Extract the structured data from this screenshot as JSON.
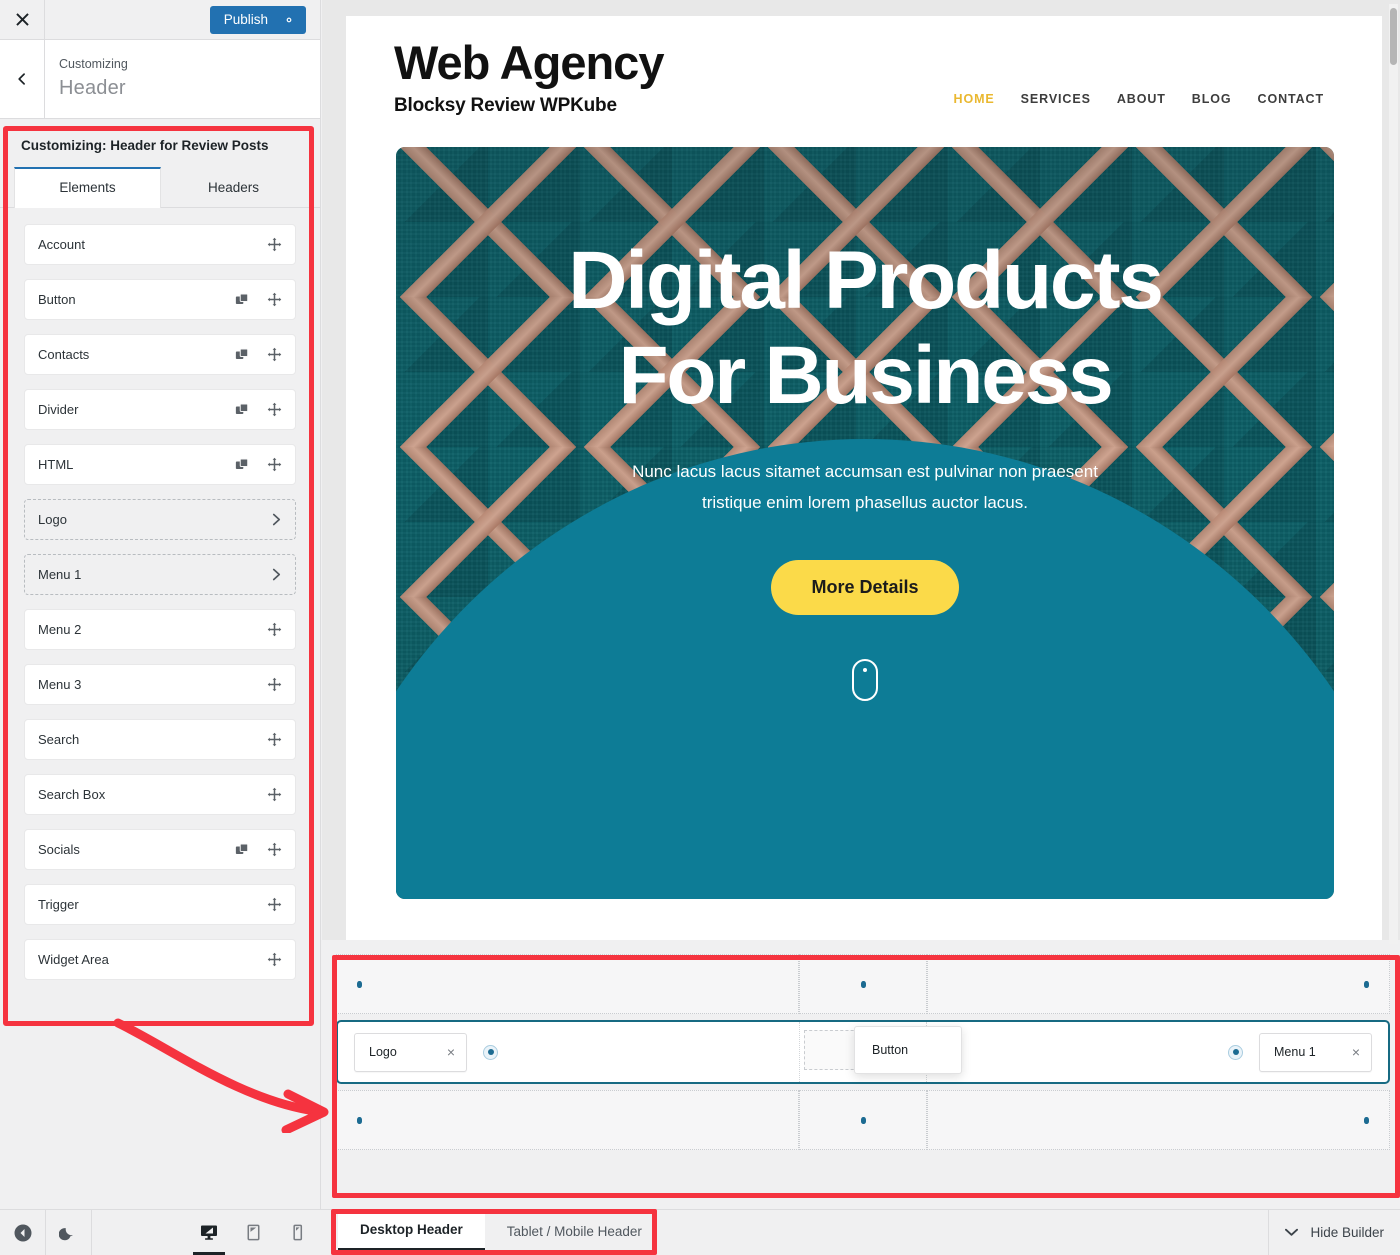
{
  "customizer": {
    "close_label": "×",
    "publish_label": "Publish",
    "gear_label": "gear-icon",
    "back_label": "‹",
    "eyebrow": "Customizing",
    "title": "Header",
    "section_title": "Customizing: Header for Review Posts",
    "tabs": [
      {
        "label": "Elements",
        "active": true
      },
      {
        "label": "Headers",
        "active": false
      }
    ],
    "elements": [
      {
        "label": "Account",
        "duplicate": false,
        "drag": true,
        "chevron": false,
        "dashed": false
      },
      {
        "label": "Button",
        "duplicate": true,
        "drag": true,
        "chevron": false,
        "dashed": false
      },
      {
        "label": "Contacts",
        "duplicate": true,
        "drag": true,
        "chevron": false,
        "dashed": false
      },
      {
        "label": "Divider",
        "duplicate": true,
        "drag": true,
        "chevron": false,
        "dashed": false
      },
      {
        "label": "HTML",
        "duplicate": true,
        "drag": true,
        "chevron": false,
        "dashed": false
      },
      {
        "label": "Logo",
        "duplicate": false,
        "drag": false,
        "chevron": true,
        "dashed": true
      },
      {
        "label": "Menu 1",
        "duplicate": false,
        "drag": false,
        "chevron": true,
        "dashed": true
      },
      {
        "label": "Menu 2",
        "duplicate": false,
        "drag": true,
        "chevron": false,
        "dashed": false
      },
      {
        "label": "Menu 3",
        "duplicate": false,
        "drag": true,
        "chevron": false,
        "dashed": false
      },
      {
        "label": "Search",
        "duplicate": false,
        "drag": true,
        "chevron": false,
        "dashed": false
      },
      {
        "label": "Search Box",
        "duplicate": false,
        "drag": true,
        "chevron": false,
        "dashed": false
      },
      {
        "label": "Socials",
        "duplicate": true,
        "drag": true,
        "chevron": false,
        "dashed": false
      },
      {
        "label": "Trigger",
        "duplicate": false,
        "drag": true,
        "chevron": false,
        "dashed": false
      },
      {
        "label": "Widget Area",
        "duplicate": false,
        "drag": true,
        "chevron": false,
        "dashed": false
      }
    ]
  },
  "preview": {
    "brand_title": "Web Agency",
    "brand_subtitle": "Blocksy Review WPKube",
    "nav": [
      {
        "label": "HOME",
        "active": true
      },
      {
        "label": "SERVICES",
        "active": false
      },
      {
        "label": "ABOUT",
        "active": false
      },
      {
        "label": "BLOG",
        "active": false
      },
      {
        "label": "CONTACT",
        "active": false
      }
    ],
    "hero": {
      "line1": "Digital Products",
      "line2": "For Business",
      "paragraph": "Nunc lacus lacus sitamet accumsan est pulvinar non praesent tristique enim lorem phasellus auctor lacus.",
      "button_label": "More Details",
      "scroll_hint": "mouse-scroll-icon",
      "button_color": "#fbda49",
      "accent_color": "#eab830",
      "dome_color": "#0d7c96"
    }
  },
  "builder": {
    "rows": [
      {
        "name": "top-row",
        "cells": [
          {
            "align": "left",
            "items": [],
            "has_dot": true
          },
          {
            "align": "center",
            "items": [],
            "has_dot": true
          },
          {
            "align": "right",
            "items": [],
            "has_dot": true
          }
        ]
      },
      {
        "name": "middle-row",
        "selected": true,
        "cells": [
          {
            "align": "left",
            "items": [
              {
                "label": "Logo",
                "removable": true
              }
            ],
            "has_dot": true
          },
          {
            "align": "center",
            "items": [],
            "has_dot": false
          },
          {
            "align": "right",
            "items": [
              {
                "label": "Menu 1",
                "removable": true
              }
            ],
            "has_dot": true
          }
        ]
      },
      {
        "name": "bottom-row",
        "cells": [
          {
            "align": "left",
            "items": [],
            "has_dot": true
          },
          {
            "align": "center",
            "items": [],
            "has_dot": true
          },
          {
            "align": "right",
            "items": [],
            "has_dot": true
          }
        ]
      }
    ],
    "dragging_item": "Button",
    "highlight_color": "#f5333f",
    "selected_row_color": "#176a82"
  },
  "bottombar": {
    "collapse_label": "collapse-sidebar-icon",
    "darkmode_label": "moon-icon",
    "devices": [
      {
        "label": "desktop-icon",
        "active": true
      },
      {
        "label": "tablet-icon",
        "active": false
      },
      {
        "label": "mobile-icon",
        "active": false
      }
    ],
    "header_tabs": [
      {
        "label": "Desktop Header",
        "active": true
      },
      {
        "label": "Tablet / Mobile Header",
        "active": false
      }
    ],
    "hide_builder_label": "Hide Builder"
  }
}
